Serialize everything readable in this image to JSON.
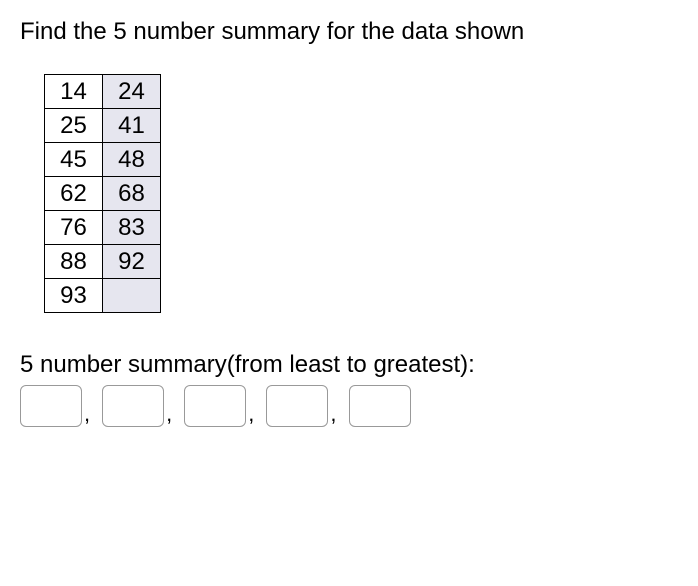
{
  "question": "Find the 5 number summary for the data shown",
  "table": {
    "rows": [
      {
        "col1": "14",
        "col2": "24"
      },
      {
        "col1": "25",
        "col2": "41"
      },
      {
        "col1": "45",
        "col2": "48"
      },
      {
        "col1": "62",
        "col2": "68"
      },
      {
        "col1": "76",
        "col2": "83"
      },
      {
        "col1": "88",
        "col2": "92"
      },
      {
        "col1": "93",
        "col2": ""
      }
    ]
  },
  "summary_label": "5 number summary(from least to greatest):",
  "answers": {
    "a1": "",
    "a2": "",
    "a3": "",
    "a4": "",
    "a5": ""
  },
  "comma": ","
}
